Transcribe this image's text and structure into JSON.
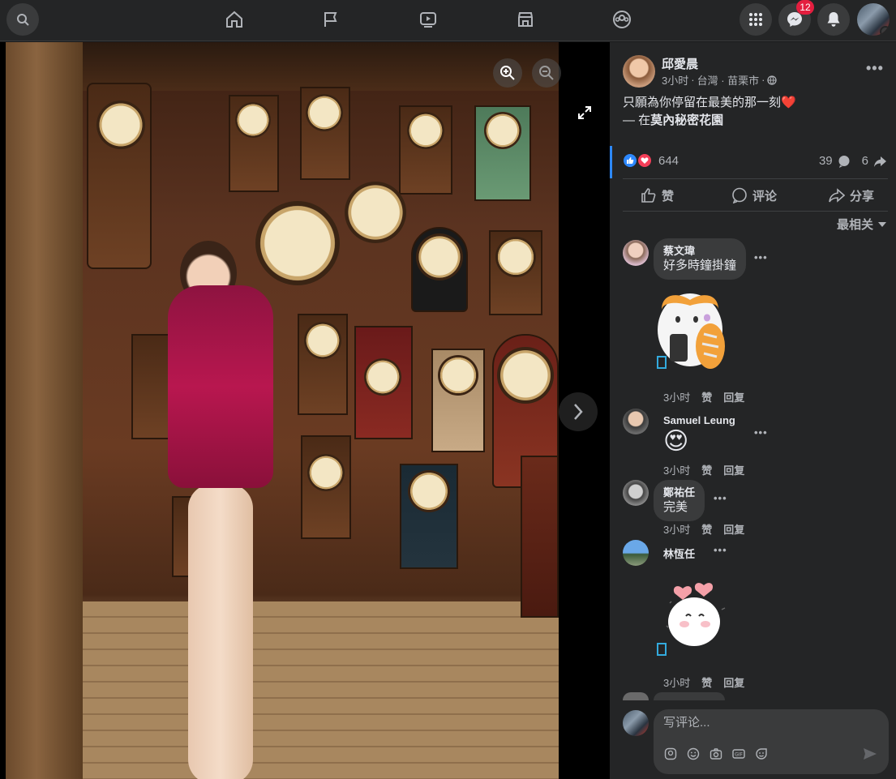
{
  "topbar": {
    "messenger_badge": "12"
  },
  "post": {
    "author": "邱愛晨",
    "time": "3小时",
    "location": "台灣 · 苗栗市",
    "caption": "只願為你停留在最美的那一刻",
    "place_prefix": "— 在",
    "place_name": "莫內秘密花園",
    "reaction_count": "644",
    "comment_count": "39",
    "share_count": "6"
  },
  "actions": {
    "like": "赞",
    "comment": "评论",
    "share": "分享",
    "sort": "最相关"
  },
  "comments": [
    {
      "name": "蔡文瑋",
      "text": "好多時鐘掛鐘",
      "time": "3小时",
      "like": "赞",
      "reply": "回复"
    },
    {
      "name": "Samuel Leung",
      "text": "😍",
      "time": "3小时",
      "like": "赞",
      "reply": "回复"
    },
    {
      "name": "鄭祐任",
      "text": "完美",
      "time": "3小时",
      "like": "赞",
      "reply": "回复"
    },
    {
      "name": "林恆任",
      "text": "",
      "time": "3小时",
      "like": "赞",
      "reply": "回复"
    }
  ],
  "composer": {
    "placeholder": "写评论..."
  },
  "colors": {
    "accent": "#2d88ff",
    "badge": "#e41e3f",
    "panel": "#242526"
  }
}
